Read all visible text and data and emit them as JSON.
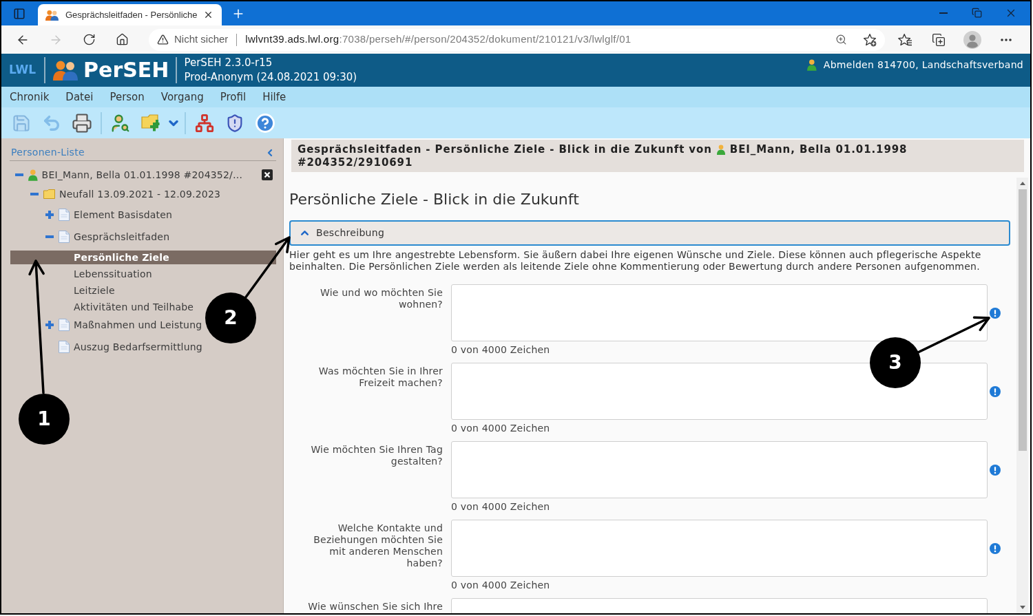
{
  "browser": {
    "tabs": [
      {
        "title": "Gesprächsleitfaden - Persönliche",
        "selected": true
      }
    ],
    "address": {
      "security": "Nicht sicher",
      "host": "lwlvnt39.ads.lwl.org",
      "path": ":7038/perseh/#/person/204352/dokument/210121/v3/lwlglf/01"
    }
  },
  "app_header": {
    "logo": "LWL",
    "app_name": "PerSEH",
    "version": "PerSEH 2.3.0-r15",
    "environment": "Prod-Anonym (24.08.2021 09:30)",
    "user": "Abmelden 814700, Landschaftsverband"
  },
  "menu": [
    "Chronik",
    "Datei",
    "Person",
    "Vorgang",
    "Profil",
    "Hilfe"
  ],
  "toolbar": [
    {
      "kind": "save",
      "disabled": true
    },
    {
      "kind": "undo",
      "disabled": true
    },
    {
      "kind": "print",
      "disabled": false
    },
    {
      "kind": "separator"
    },
    {
      "kind": "person-search",
      "disabled": false
    },
    {
      "kind": "folder-add",
      "disabled": false
    },
    {
      "kind": "dropdown",
      "disabled": false
    },
    {
      "kind": "separator"
    },
    {
      "kind": "network",
      "disabled": false
    },
    {
      "kind": "shield",
      "disabled": false
    },
    {
      "kind": "help",
      "disabled": false
    }
  ],
  "sidebar": {
    "title": "Personen-Liste",
    "tree": [
      {
        "kind": "person",
        "label": "BEI_Mann, Bella 01.01.1998 #204352/…",
        "expanded": true,
        "selected": false,
        "children": [
          {
            "kind": "folder",
            "label": "Neufall 13.09.2021 - 12.09.2023",
            "expanded": true,
            "selected": false,
            "children": [
              {
                "kind": "document",
                "label": "Element Basisdaten",
                "expanded": false,
                "selected": false
              },
              {
                "kind": "document",
                "label": "Gesprächsleitfaden",
                "expanded": true,
                "selected": false,
                "children": [
                  {
                    "kind": "page",
                    "label": "Persönliche Ziele",
                    "selected": true
                  },
                  {
                    "kind": "page",
                    "label": "Lebenssituation",
                    "selected": false
                  },
                  {
                    "kind": "page",
                    "label": "Leitziele",
                    "selected": false
                  },
                  {
                    "kind": "page",
                    "label": "Aktivitäten und Teilhabe",
                    "selected": false
                  }
                ]
              },
              {
                "kind": "document",
                "label": "Maßnahmen und Leistung",
                "expanded": false,
                "selected": false
              },
              {
                "kind": "document",
                "label": "Auszug Bedarfsermittlung",
                "selected": false
              }
            ]
          }
        ]
      }
    ]
  },
  "content": {
    "heading": {
      "title": "Gesprächsleitfaden - Persönliche Ziele - Blick in die Zukunft von",
      "person": "BEI_Mann, Bella 01.01.1998",
      "case_id": "#204352/2910691"
    },
    "title": "Persönliche Ziele - Blick in die Zukunft",
    "description": {
      "label": "Beschreibung",
      "expanded": true,
      "text": "Hier geht es um Ihre angestrebte Lebensform. Sie äußern dabei Ihre eigenen Wünsche und Ziele. Diese können auch pflegerische Aspekte beinhalten. Die Persönlichen Ziele werden als leitende Ziele ohne Kommentierung oder Bewertung durch andere Personen aufgenommen."
    },
    "questions": [
      {
        "label": "Wie und wo möchten Sie wohnen?",
        "counter": "0 von 4000 Zeichen"
      },
      {
        "label": "Was möchten Sie in Ihrer Freizeit machen?",
        "counter": "0 von 4000 Zeichen"
      },
      {
        "label": "Wie möchten Sie Ihren Tag gestalten?",
        "counter": "0 von 4000 Zeichen"
      },
      {
        "label": "Welche Kontakte und Beziehungen möchten Sie mit anderen Menschen haben?",
        "counter": "0 von 4000 Zeichen"
      },
      {
        "label": "Wie wünschen Sie sich Ihre"
      }
    ]
  },
  "callouts": [
    {
      "number": "1"
    },
    {
      "number": "2"
    },
    {
      "number": "3"
    }
  ]
}
